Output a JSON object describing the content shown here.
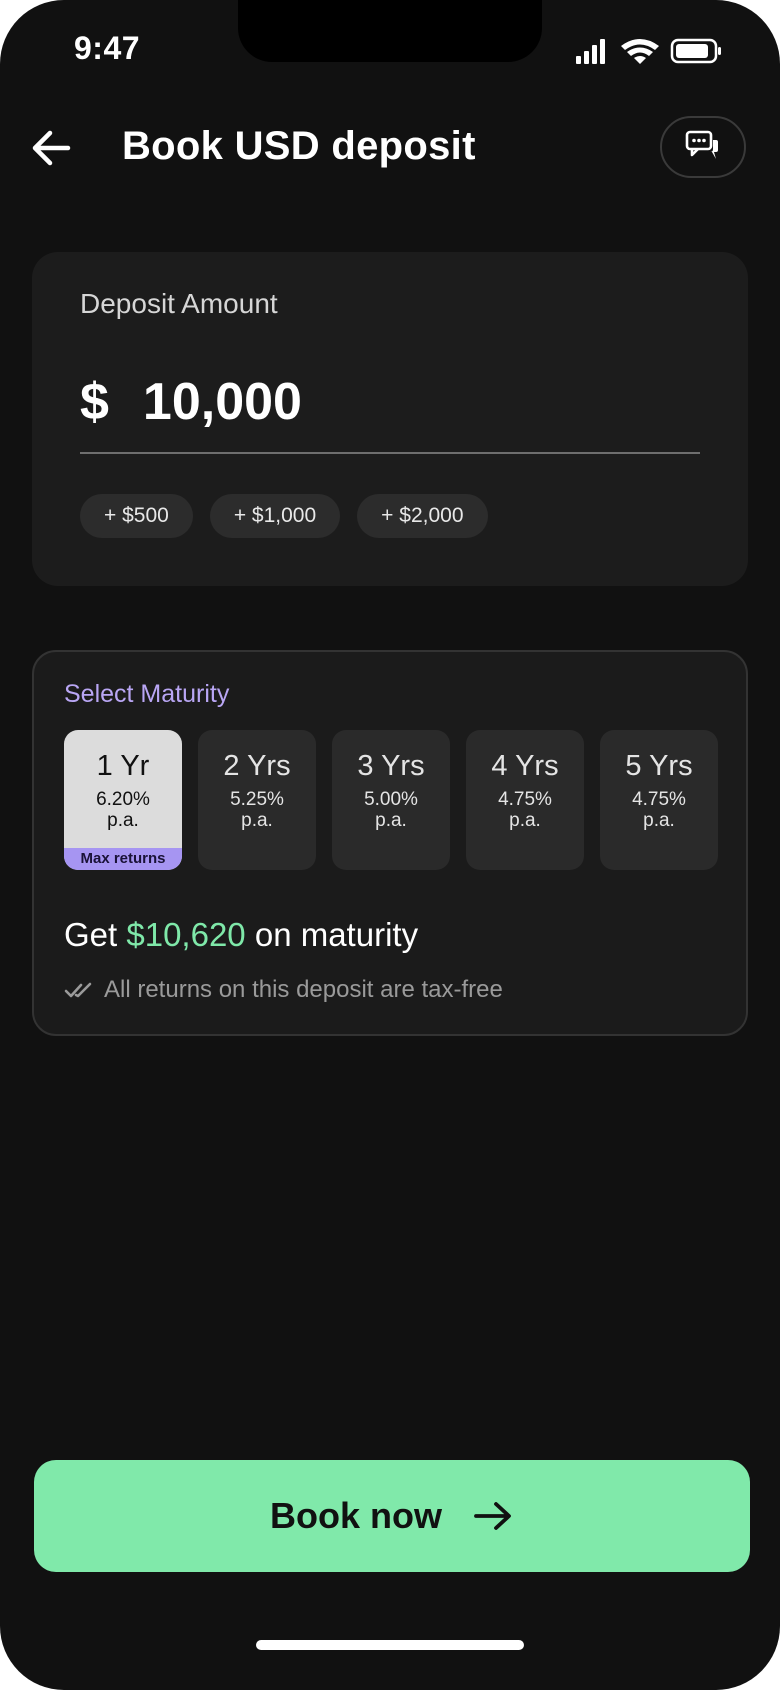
{
  "status_bar": {
    "time": "9:47"
  },
  "header": {
    "title": "Book USD deposit",
    "back_icon": "arrow-left-icon",
    "chat_icon": "chat-bubbles-icon"
  },
  "deposit": {
    "label": "Deposit Amount",
    "currency_symbol": "$",
    "amount": "10,000",
    "quick_add": [
      "+ $500",
      "+ $1,000",
      "+ $2,000"
    ]
  },
  "maturity": {
    "title": "Select Maturity",
    "options": [
      {
        "label": "1 Yr",
        "rate": "6.20%",
        "unit": "p.a.",
        "badge": "Max returns",
        "selected": true
      },
      {
        "label": "2 Yrs",
        "rate": "5.25%",
        "unit": "p.a.",
        "selected": false
      },
      {
        "label": "3 Yrs",
        "rate": "5.00%",
        "unit": "p.a.",
        "selected": false
      },
      {
        "label": "4 Yrs",
        "rate": "4.75%",
        "unit": "p.a.",
        "selected": false
      },
      {
        "label": "5 Yrs",
        "rate": "4.75%",
        "unit": "p.a.",
        "selected": false
      }
    ],
    "summary_prefix": "Get",
    "summary_amount": "$10,620",
    "summary_suffix": "on maturity",
    "tax_note": "All returns on this deposit are tax-free",
    "tax_icon": "double-check-icon"
  },
  "cta": {
    "label": "Book now",
    "icon": "arrow-right-icon"
  },
  "colors": {
    "background": "#111111",
    "card": "#1c1c1c",
    "accent_green": "#80e9aa",
    "accent_purple": "#a695f2",
    "selected_tile": "#dcdcdc"
  }
}
